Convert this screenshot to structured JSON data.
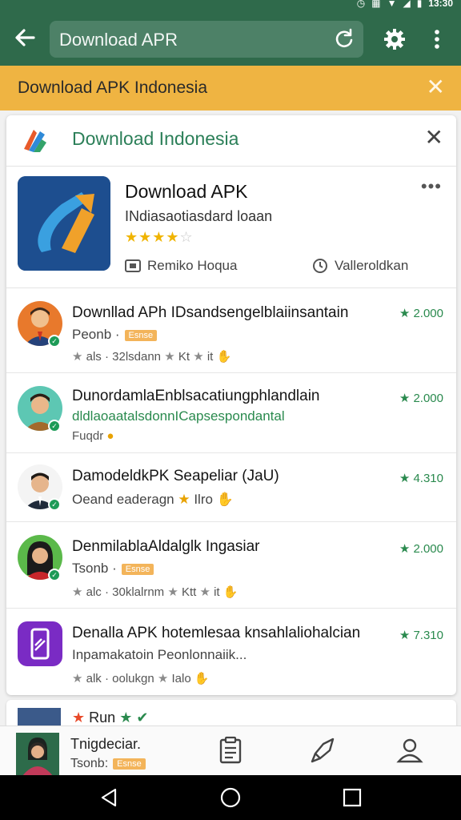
{
  "status_bar": {
    "time": "13:30"
  },
  "app_bar": {
    "search_query": "Download APR"
  },
  "banner": {
    "text": "Download APK Indonesia"
  },
  "popup": {
    "title": "Download Indonesia",
    "hero": {
      "name": "Download APK",
      "subtitle": "INdiasaotiasdard loaan",
      "rating_stars": 4,
      "developer": "Remiko Hoqua",
      "version": "Valleroldkan"
    },
    "rows": [
      {
        "title": "Downllad APh IDsandsengelblaiinsantain",
        "subtitle": "Peonb ·",
        "tag": "Esnse",
        "meta": "als · 32lsdann",
        "meta2": "Kt",
        "meta3": "it",
        "rating": "2.000"
      },
      {
        "title": "DunordamlaEnblsacatiungphlandlain",
        "subtitle": "dldlaoaatalsdonnICapsespondantal",
        "meta": "Fuqdr",
        "rating": "2.000"
      },
      {
        "title": "DamodeldkPK Seapeliar (JaU)",
        "subtitle": "Oeand eaderagn",
        "meta2": "Ilro",
        "rating": "4.310"
      },
      {
        "title": "DenmilablaAldalglk Ingasiar",
        "subtitle": "Tsonb ·",
        "tag": "Esnse",
        "meta": "alc · 30klalrnm",
        "meta2": "Ktt",
        "meta3": "it",
        "rating": "2.000"
      },
      {
        "title": "Denalla APK hotemlesaa knsahlaliohalcian",
        "subtitle": "Inpamakatoin Peonlonnaiik...",
        "meta": "alk · oolukgn",
        "meta2": "Ialo",
        "rating": "7.310"
      }
    ]
  },
  "partial_card": {
    "text": "Run"
  },
  "bottom_nav": {
    "mini_title": "Tnigdeciar.",
    "mini_sub": "Tsonb:",
    "mini_tag": "Esnse"
  },
  "colors": {
    "primary": "#2f6a4b",
    "banner": "#efb442",
    "accent_green": "#2a8a4e",
    "star": "#f0b400"
  }
}
